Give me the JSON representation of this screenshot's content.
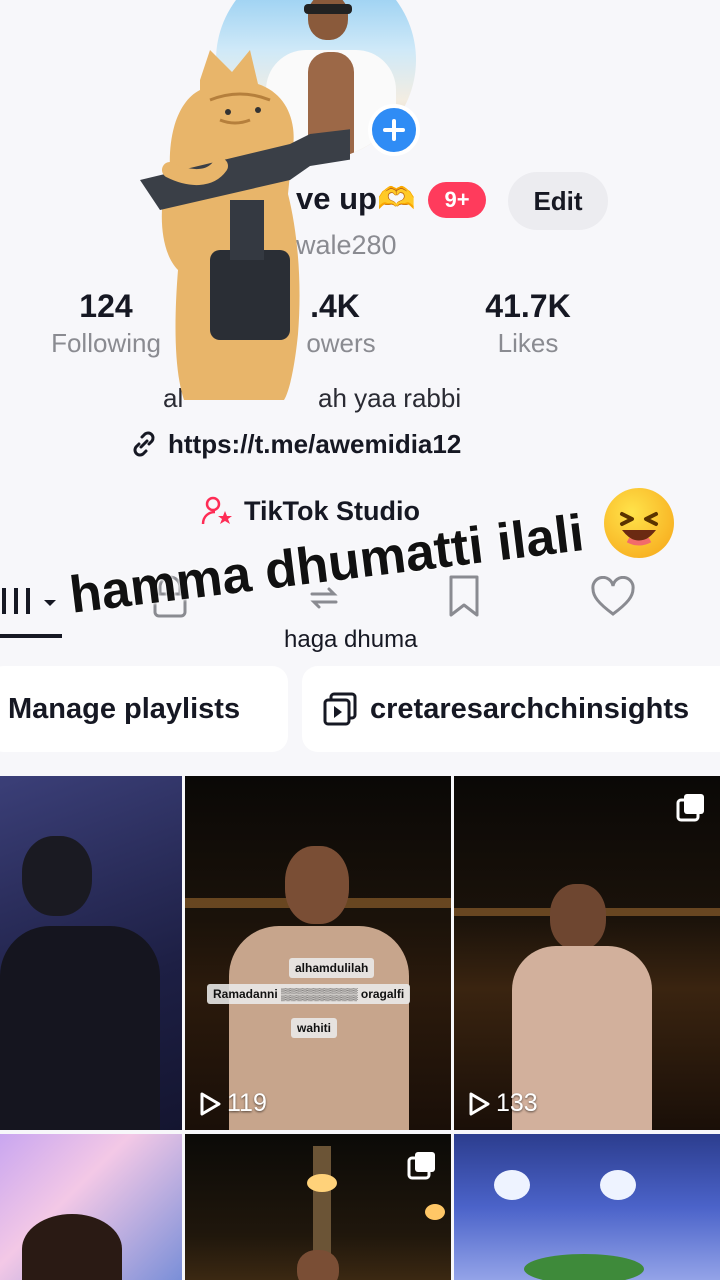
{
  "profile": {
    "username": "ve up🫶",
    "notification_badge": "9+",
    "edit_label": "Edit",
    "handle": "wale280",
    "bio_left": "al",
    "bio_right": "ah yaa rabbi",
    "link": "https://t.me/awemidia12",
    "studio_label": "TikTok Studio"
  },
  "stats": [
    {
      "value": "124",
      "label": "Following"
    },
    {
      "value": ".4K",
      "label": "owers"
    },
    {
      "value": "41.7K",
      "label": "Likes"
    }
  ],
  "tabs": {
    "repost_label": "haga dhuma"
  },
  "overlay": {
    "caption": "hamma dhumatti ilali",
    "emoji": "laughing-squint-emoji"
  },
  "chips": [
    {
      "label": "Manage playlists"
    },
    {
      "label": "cretaresarchchinsights",
      "icon": "playlist-icon"
    }
  ],
  "videos": [
    {
      "views": ""
    },
    {
      "views": "119",
      "captions": [
        "alhamdulilah",
        "Ramadanni",
        "oragalfi",
        "wahiti"
      ]
    },
    {
      "views": "133"
    },
    {
      "views": ""
    },
    {
      "views": ""
    },
    {
      "views": ""
    }
  ],
  "colors": {
    "accent_blue": "#2f8cf5",
    "badge_red": "#ff3b5c",
    "studio_pink": "#fe2c55"
  }
}
